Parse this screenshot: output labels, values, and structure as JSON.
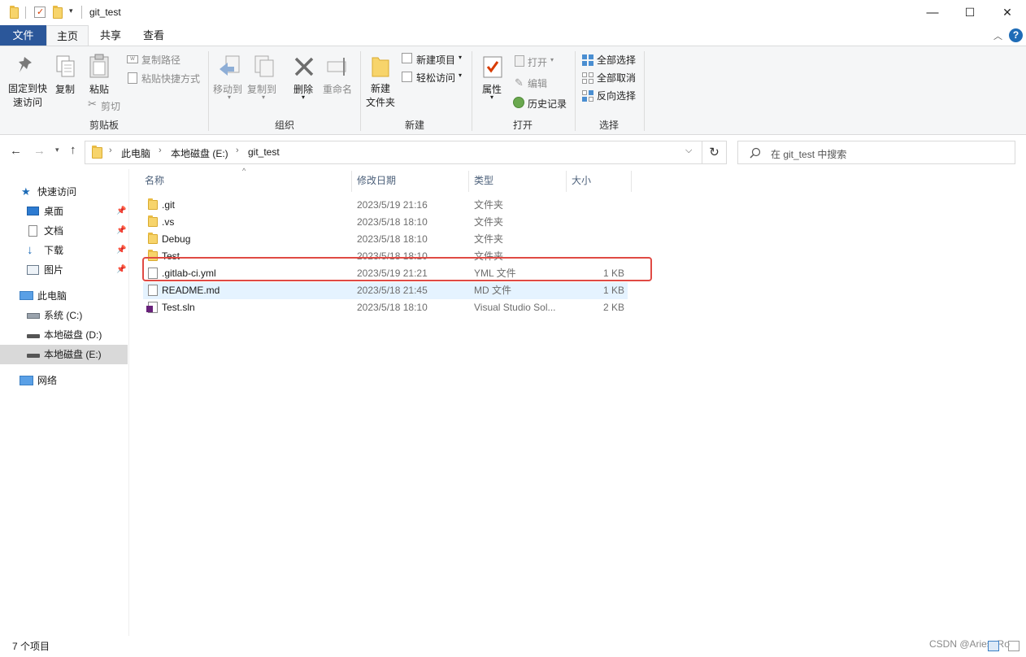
{
  "window": {
    "title": "git_test",
    "minimize_glyph": "—",
    "maximize_glyph": "☐",
    "close_glyph": "✕"
  },
  "menu": {
    "file": "文件",
    "home": "主页",
    "share": "共享",
    "view": "查看"
  },
  "ribbon": {
    "clipboard": {
      "label": "剪贴板",
      "pin": "固定到快速访问",
      "pin_line1": "固定到快",
      "pin_line2": "速访问",
      "copy": "复制",
      "paste": "粘贴",
      "copy_path": "复制路径",
      "paste_shortcut": "粘贴快捷方式",
      "cut": "剪切"
    },
    "organize": {
      "label": "组织",
      "move_to": "移动到",
      "copy_to": "复制到",
      "delete": "删除",
      "rename": "重命名"
    },
    "new": {
      "label": "新建",
      "new_folder_line1": "新建",
      "new_folder_line2": "文件夹",
      "new_item": "新建项目",
      "easy_access": "轻松访问"
    },
    "open": {
      "label": "打开",
      "properties": "属性",
      "open": "打开",
      "edit": "编辑",
      "history": "历史记录"
    },
    "select": {
      "label": "选择",
      "select_all": "全部选择",
      "select_none": "全部取消",
      "invert": "反向选择"
    }
  },
  "address": {
    "crumbs": [
      "此电脑",
      "本地磁盘 (E:)",
      "git_test"
    ],
    "search_placeholder": "在 git_test 中搜索"
  },
  "nav": {
    "quick_access": "快速访问",
    "items": [
      {
        "label": "桌面",
        "icon": "desktop-icon",
        "pinned": true
      },
      {
        "label": "文档",
        "icon": "document-icon",
        "pinned": true
      },
      {
        "label": "下载",
        "icon": "download-icon",
        "pinned": true
      },
      {
        "label": "图片",
        "icon": "picture-icon",
        "pinned": true
      }
    ],
    "this_pc": "此电脑",
    "drives": [
      "系统 (C:)",
      "本地磁盘 (D:)",
      "本地磁盘 (E:)"
    ],
    "network": "网络"
  },
  "columns": {
    "name": "名称",
    "modified": "修改日期",
    "type": "类型",
    "size": "大小"
  },
  "files": [
    {
      "name": ".git",
      "modified": "2023/5/19 21:16",
      "type": "文件夹",
      "size": "",
      "icon": "folder-icon"
    },
    {
      "name": ".vs",
      "modified": "2023/5/18 18:10",
      "type": "文件夹",
      "size": "",
      "icon": "folder-icon"
    },
    {
      "name": "Debug",
      "modified": "2023/5/18 18:10",
      "type": "文件夹",
      "size": "",
      "icon": "folder-icon"
    },
    {
      "name": "Test",
      "modified": "2023/5/18 18:10",
      "type": "文件夹",
      "size": "",
      "icon": "folder-icon"
    },
    {
      "name": ".gitlab-ci.yml",
      "modified": "2023/5/19 21:21",
      "type": "YML 文件",
      "size": "1 KB",
      "icon": "file-icon"
    },
    {
      "name": "README.md",
      "modified": "2023/5/18 21:45",
      "type": "MD 文件",
      "size": "1 KB",
      "icon": "file-icon"
    },
    {
      "name": "Test.sln",
      "modified": "2023/5/18 18:10",
      "type": "Visual Studio Sol...",
      "size": "2 KB",
      "icon": "solution-icon"
    }
  ],
  "status": {
    "count": "7 个项目"
  },
  "watermark": "CSDN @Aries_Ro",
  "colors": {
    "accent": "#1e6cb7",
    "highlight_box": "#e04a44",
    "selected_row": "#e5f3ff",
    "file_tab": "#2b579a"
  }
}
